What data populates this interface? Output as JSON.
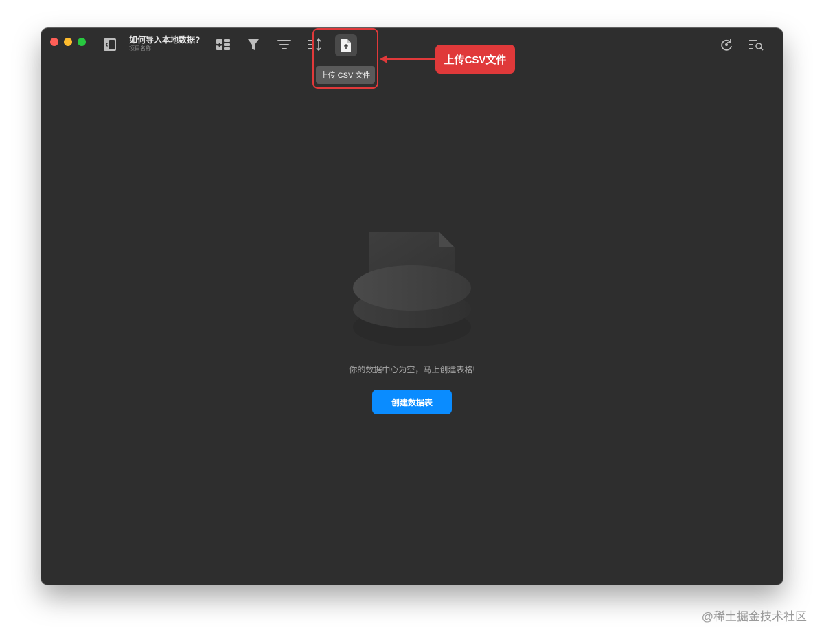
{
  "window": {
    "title": "如何导入本地数据?",
    "subtitle": "项目名称"
  },
  "toolbar": {
    "left_icons": [
      "sidebar-toggle-icon",
      "add-record-icon",
      "filter-icon",
      "sort-icon",
      "row-height-icon",
      "upload-csv-icon"
    ],
    "right_icons": [
      "sync-icon",
      "search-list-icon"
    ],
    "tooltip": "上传 CSV 文件"
  },
  "main": {
    "empty_message": "你的数据中心为空，马上创建表格!",
    "create_button_label": "创建数据表"
  },
  "annotation": {
    "label": "上传CSV文件",
    "color": "#e0393a"
  },
  "watermark": "@稀土掘金技术社区",
  "colors": {
    "window_bg": "#2e2e2e",
    "accent": "#0a8cff",
    "tooltip_bg": "#5a5a5a"
  }
}
